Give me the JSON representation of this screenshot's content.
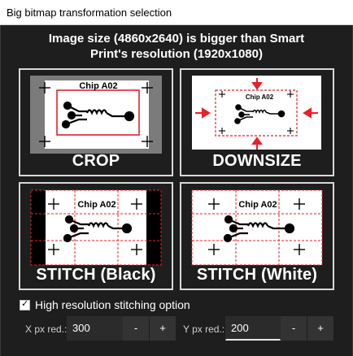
{
  "window": {
    "title": "Big bitmap transformation selection"
  },
  "message": {
    "line1": "Image size (4860x2640) is bigger than Smart",
    "line2": "Print's resolution (1920x1080)"
  },
  "chip_text": "Chip A02",
  "options": [
    {
      "id": "crop",
      "label": "CROP"
    },
    {
      "id": "downsize",
      "label": "DOWNSIZE"
    },
    {
      "id": "stitch-black",
      "label": "STITCH (Black)"
    },
    {
      "id": "stitch-white",
      "label": "STITCH (White)"
    }
  ],
  "stitching": {
    "checkbox_label": "High resolution stitching option",
    "checked": true,
    "x_label": "X px red.:",
    "x_value": "300",
    "y_label": "Y px red.:",
    "y_value": "200",
    "minus": "-",
    "plus": "+"
  },
  "colors": {
    "accent_red": "#e8202a",
    "card_border": "#d8d8d8",
    "background": "#1e1e1e"
  }
}
